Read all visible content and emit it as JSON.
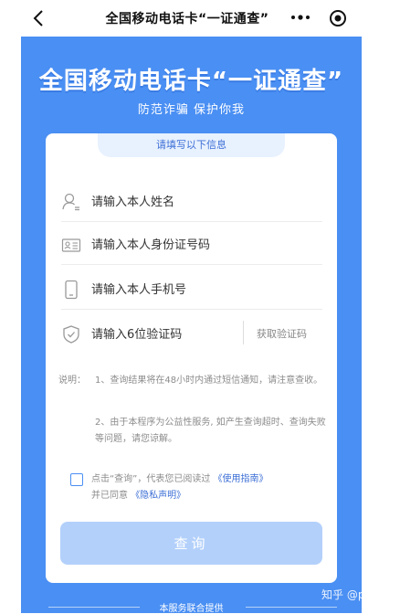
{
  "nav": {
    "title": "全国移动电话卡“一证通查”",
    "back_icon": "chevron-left-icon",
    "more_icon": "more-dots-icon",
    "target_icon": "target-circle-icon"
  },
  "hero": {
    "title": "全国移动电话卡“一证通查”",
    "subtitle": "防范诈骗 保护你我"
  },
  "form": {
    "tab_label": "请填写以下信息",
    "name_placeholder": "请输入本人姓名",
    "id_placeholder": "请输入本人身份证号码",
    "phone_placeholder": "请输入本人手机号",
    "code_placeholder": "请输入6位验证码",
    "get_code_label": "获取验证码"
  },
  "notes": {
    "label": "说明：",
    "item1": "1、查询结果将在48小时内通过短信通知，请注意查收。",
    "item2": "2、由于本程序为公益性服务, 如产生查询超时、查询失败等问题，请您谅解。"
  },
  "agreement": {
    "prefix": "点击“查询”，代表您已阅读过 ",
    "guide_link": "《使用指南》",
    "line2_prefix": "并已同意 ",
    "privacy_link": "《隐私声明》"
  },
  "query_button_label": "查询",
  "footer": {
    "text": "本服务联合提供"
  },
  "watermark": "知乎 @poly",
  "colors": {
    "brand_blue": "#4a8ff3",
    "button_disabled": "#b3d0fb",
    "link": "#3d6fd6"
  }
}
